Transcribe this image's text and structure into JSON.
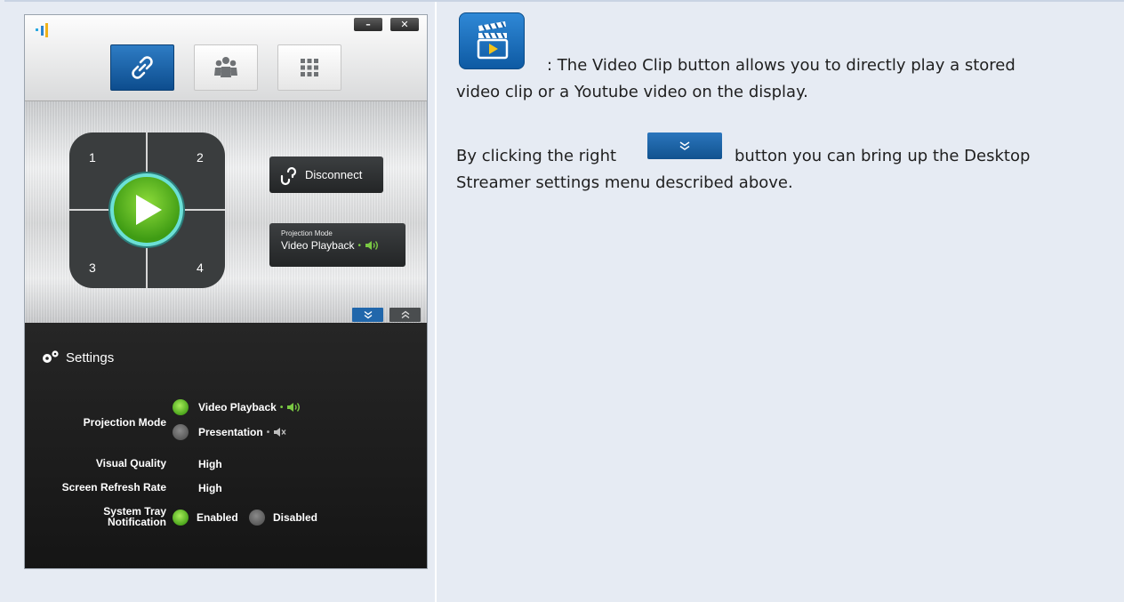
{
  "app": {
    "window_controls": {
      "minimize": "–",
      "close": "✕"
    },
    "quadrants": [
      "1",
      "2",
      "3",
      "4"
    ],
    "disconnect_label": "Disconnect",
    "projection_box": {
      "title": "Projection Mode",
      "value": "Video Playback"
    },
    "settings": {
      "title": "Settings",
      "projection_mode": {
        "label": "Projection Mode",
        "options": [
          {
            "label": "Video Playback",
            "selected": true
          },
          {
            "label": "Presentation",
            "selected": false
          }
        ]
      },
      "visual_quality": {
        "label": "Visual Quality",
        "value": "High"
      },
      "screen_refresh_rate": {
        "label": "Screen Refresh Rate",
        "value": "High"
      },
      "system_tray": {
        "label_line1": "System Tray",
        "label_line2": "Notification",
        "options": [
          {
            "label": "Enabled",
            "selected": true
          },
          {
            "label": "Disabled",
            "selected": false
          }
        ]
      }
    },
    "colors": {
      "accent_blue": "#2167ab",
      "active_green": "#5cb82a",
      "panel_dark": "#1e1e1e"
    }
  },
  "doc": {
    "para1_line1": ": The Video Clip button allows you to directly play a stored",
    "para1_line2": "video clip or a Youtube video on the display.",
    "para2_before": "By clicking the right",
    "para2_after": "button you can bring up the Desktop",
    "para2_line2": "Streamer settings menu described above."
  }
}
